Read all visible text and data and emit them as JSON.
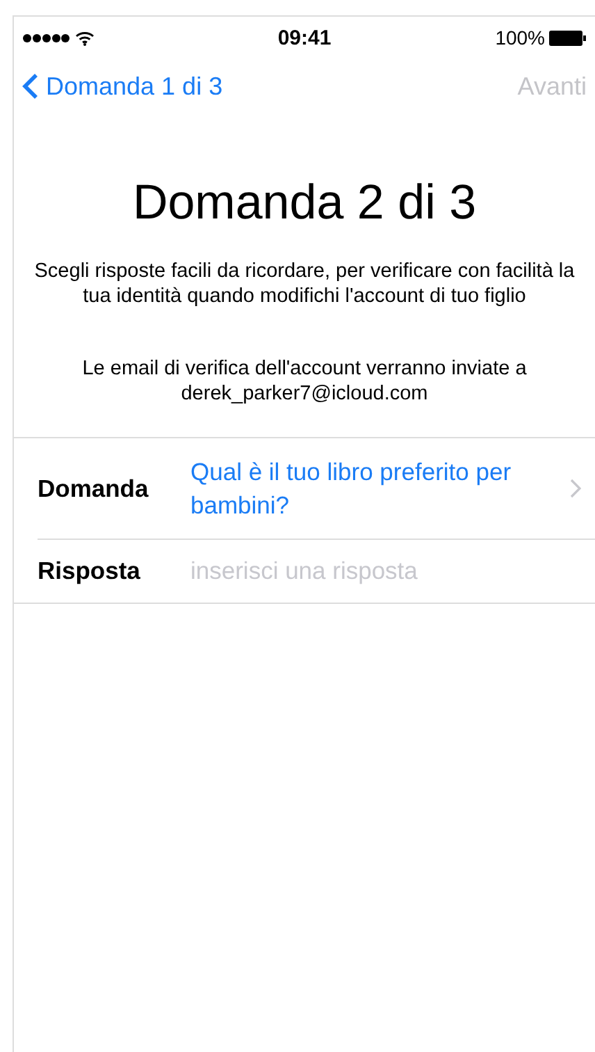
{
  "status_bar": {
    "time": "09:41",
    "battery": "100%"
  },
  "nav": {
    "back": "Domanda 1 di 3",
    "next": {
      "label": "Avanti",
      "disabled": true
    }
  },
  "title": "Domanda 2 di 3",
  "description": "Scegli risposte facili da ricordare, per verificare con facilità la tua identità quando modifichi l'account di tuo figlio",
  "email_note": "Le email di verifica dell'account verranno inviate a derek_parker7@icloud.com",
  "form": [
    {
      "kind": "picker",
      "label": "Domanda",
      "value": "Qual è il tuo libro preferito per bambini?"
    },
    {
      "kind": "input",
      "label": "Risposta",
      "placeholder": "inserisci una risposta"
    }
  ]
}
